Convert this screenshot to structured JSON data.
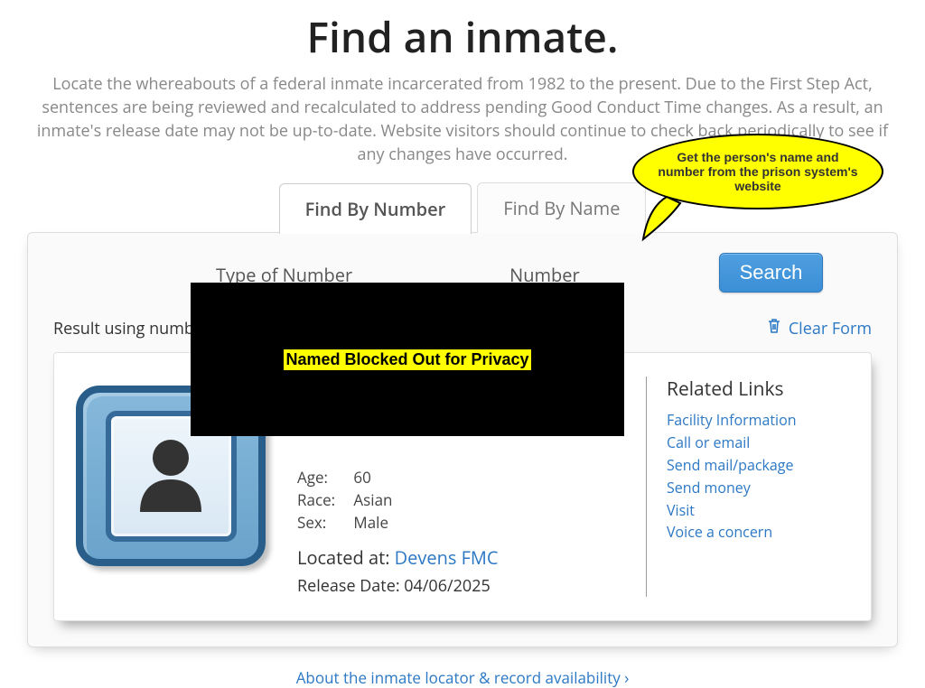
{
  "page": {
    "title": "Find an inmate.",
    "intro": "Locate the whereabouts of a federal inmate incarcerated from 1982 to the present. Due to the First Step Act, sentences are being reviewed and recalculated to address pending Good Conduct Time changes. As a result, an inmate's release date may not be up-to-date. Website visitors should continue to check back periodically to see if any changes have occurred."
  },
  "tabs": {
    "number": "Find By Number",
    "name": "Find By Name"
  },
  "form": {
    "type_label": "Type of Number",
    "number_label": "Number",
    "search_btn": "Search",
    "clear_btn": "Clear Form",
    "result_prefix": "Result using number"
  },
  "redaction": {
    "label": "Named Blocked Out for Privacy"
  },
  "annotation": {
    "text": "Get the person's name and number from the prison system's website"
  },
  "result": {
    "fields": {
      "age_label": "Age:",
      "age_value": "60",
      "race_label": "Race:",
      "race_value": "Asian",
      "sex_label": "Sex:",
      "sex_value": "Male"
    },
    "located_label": "Located at: ",
    "located_value": "Devens FMC",
    "release_label": "Release Date: ",
    "release_value": "04/06/2025"
  },
  "related": {
    "heading": "Related Links",
    "links": {
      "facility": "Facility Information",
      "contact": "Call or email",
      "mail": "Send mail/package",
      "money": "Send money",
      "visit": "Visit",
      "concern": "Voice a concern"
    }
  },
  "footer": {
    "about_link": "About the inmate locator & record availability ›"
  }
}
